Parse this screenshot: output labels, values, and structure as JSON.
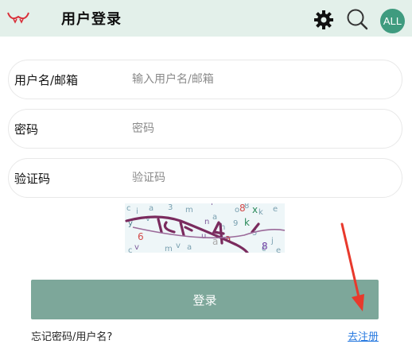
{
  "header": {
    "title": "用户登录",
    "avatar_text": "ALL",
    "logo_icon": "mustache-logo-icon",
    "settings_icon": "gear-icon",
    "search_icon": "search-icon"
  },
  "form": {
    "username": {
      "label": "用户名/邮箱",
      "placeholder": "输入用户名/邮箱",
      "value": ""
    },
    "password": {
      "label": "密码",
      "placeholder": "密码",
      "value": ""
    },
    "captcha": {
      "label": "验证码",
      "placeholder": "验证码",
      "value": ""
    }
  },
  "captcha_image": {
    "text": "94"
  },
  "login_button": "登录",
  "forgot_link": "忘记密码/用户名?",
  "register_link": "去注册",
  "colors": {
    "header_bg": "#e3f0ea",
    "avatar_bg": "#3f9b7f",
    "button_bg": "#7da79a",
    "link": "#2a7be0",
    "annotation_arrow": "#e8392c"
  }
}
